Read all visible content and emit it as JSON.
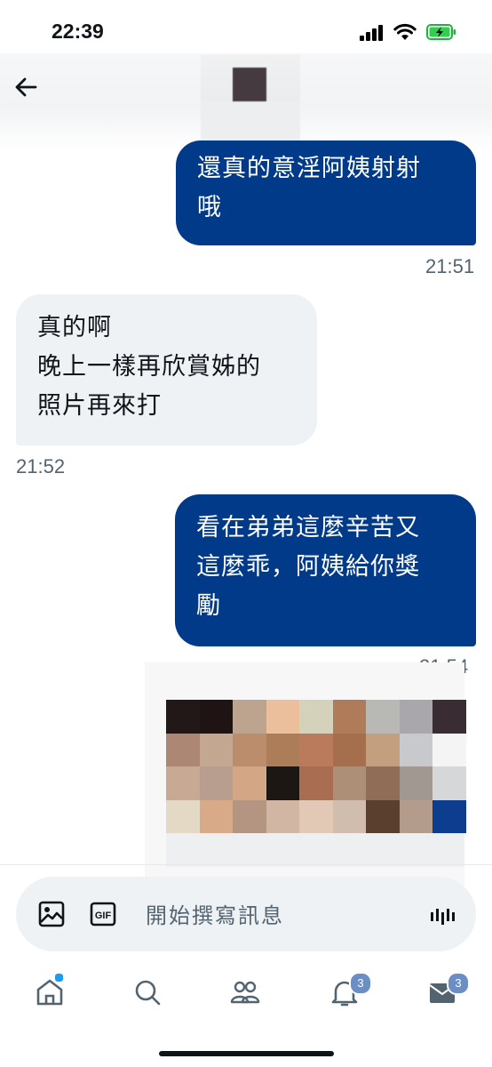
{
  "status_bar": {
    "time": "22:39"
  },
  "header": {
    "back_icon": "arrow-left-icon"
  },
  "messages": [
    {
      "direction": "sent",
      "lines": [
        "還真的意淫阿姨射射",
        "哦"
      ]
    },
    {
      "timestamp": "21:51"
    },
    {
      "direction": "received",
      "lines": [
        "真的啊",
        "晚上一樣再欣賞姊的",
        "照片再來打"
      ]
    },
    {
      "timestamp": "21:52"
    },
    {
      "direction": "sent",
      "lines": [
        "看在弟弟這麼辛苦又",
        "這麼乖，阿姨給你獎",
        "勵"
      ]
    },
    {
      "timestamp": "21:54"
    }
  ],
  "media": {
    "pixel_colors": [
      [
        "#231818",
        "#1f1413",
        "#bca48f",
        "#ebbf9b",
        "#d5d2bc",
        "#b07b58",
        "#b8b9b5",
        "#a9a7ab",
        "#3a2c33"
      ],
      [
        "#ab8774",
        "#c3a791",
        "#bb8d6c",
        "#ad7c58",
        "#b97b5b",
        "#a56e4c",
        "#c39e7f",
        "#c8c9cc",
        "#f4f4f5"
      ],
      [
        "#c8a994",
        "#b79e8e",
        "#d3a786",
        "#1c1713",
        "#a96d52",
        "#ad8f77",
        "#8f6d57",
        "#a09891",
        "#d6d7d8"
      ],
      [
        "#e4d9c5",
        "#d8aa88",
        "#b39581",
        "#d0b6a3",
        "#e1c9b6",
        "#d0bdad",
        "#5a3e2e",
        "#b49c8c",
        "#0d3d8e"
      ]
    ]
  },
  "composer": {
    "placeholder": "開始撰寫訊息",
    "image_icon": "image-icon",
    "gif_icon": "gif-icon",
    "gif_label": "GIF",
    "voice_icon": "voice-waveform-icon"
  },
  "tab_bar": {
    "items": [
      {
        "icon": "home-icon"
      },
      {
        "icon": "search-icon"
      },
      {
        "icon": "communities-icon"
      },
      {
        "icon": "bell-icon",
        "badge": "3"
      },
      {
        "icon": "mail-icon",
        "badge": "3"
      }
    ]
  },
  "colors": {
    "sent_bubble": "#023a8a",
    "received_bubble": "#eff2f5",
    "badge": "#6b8ec4",
    "timestamp": "#536471"
  }
}
